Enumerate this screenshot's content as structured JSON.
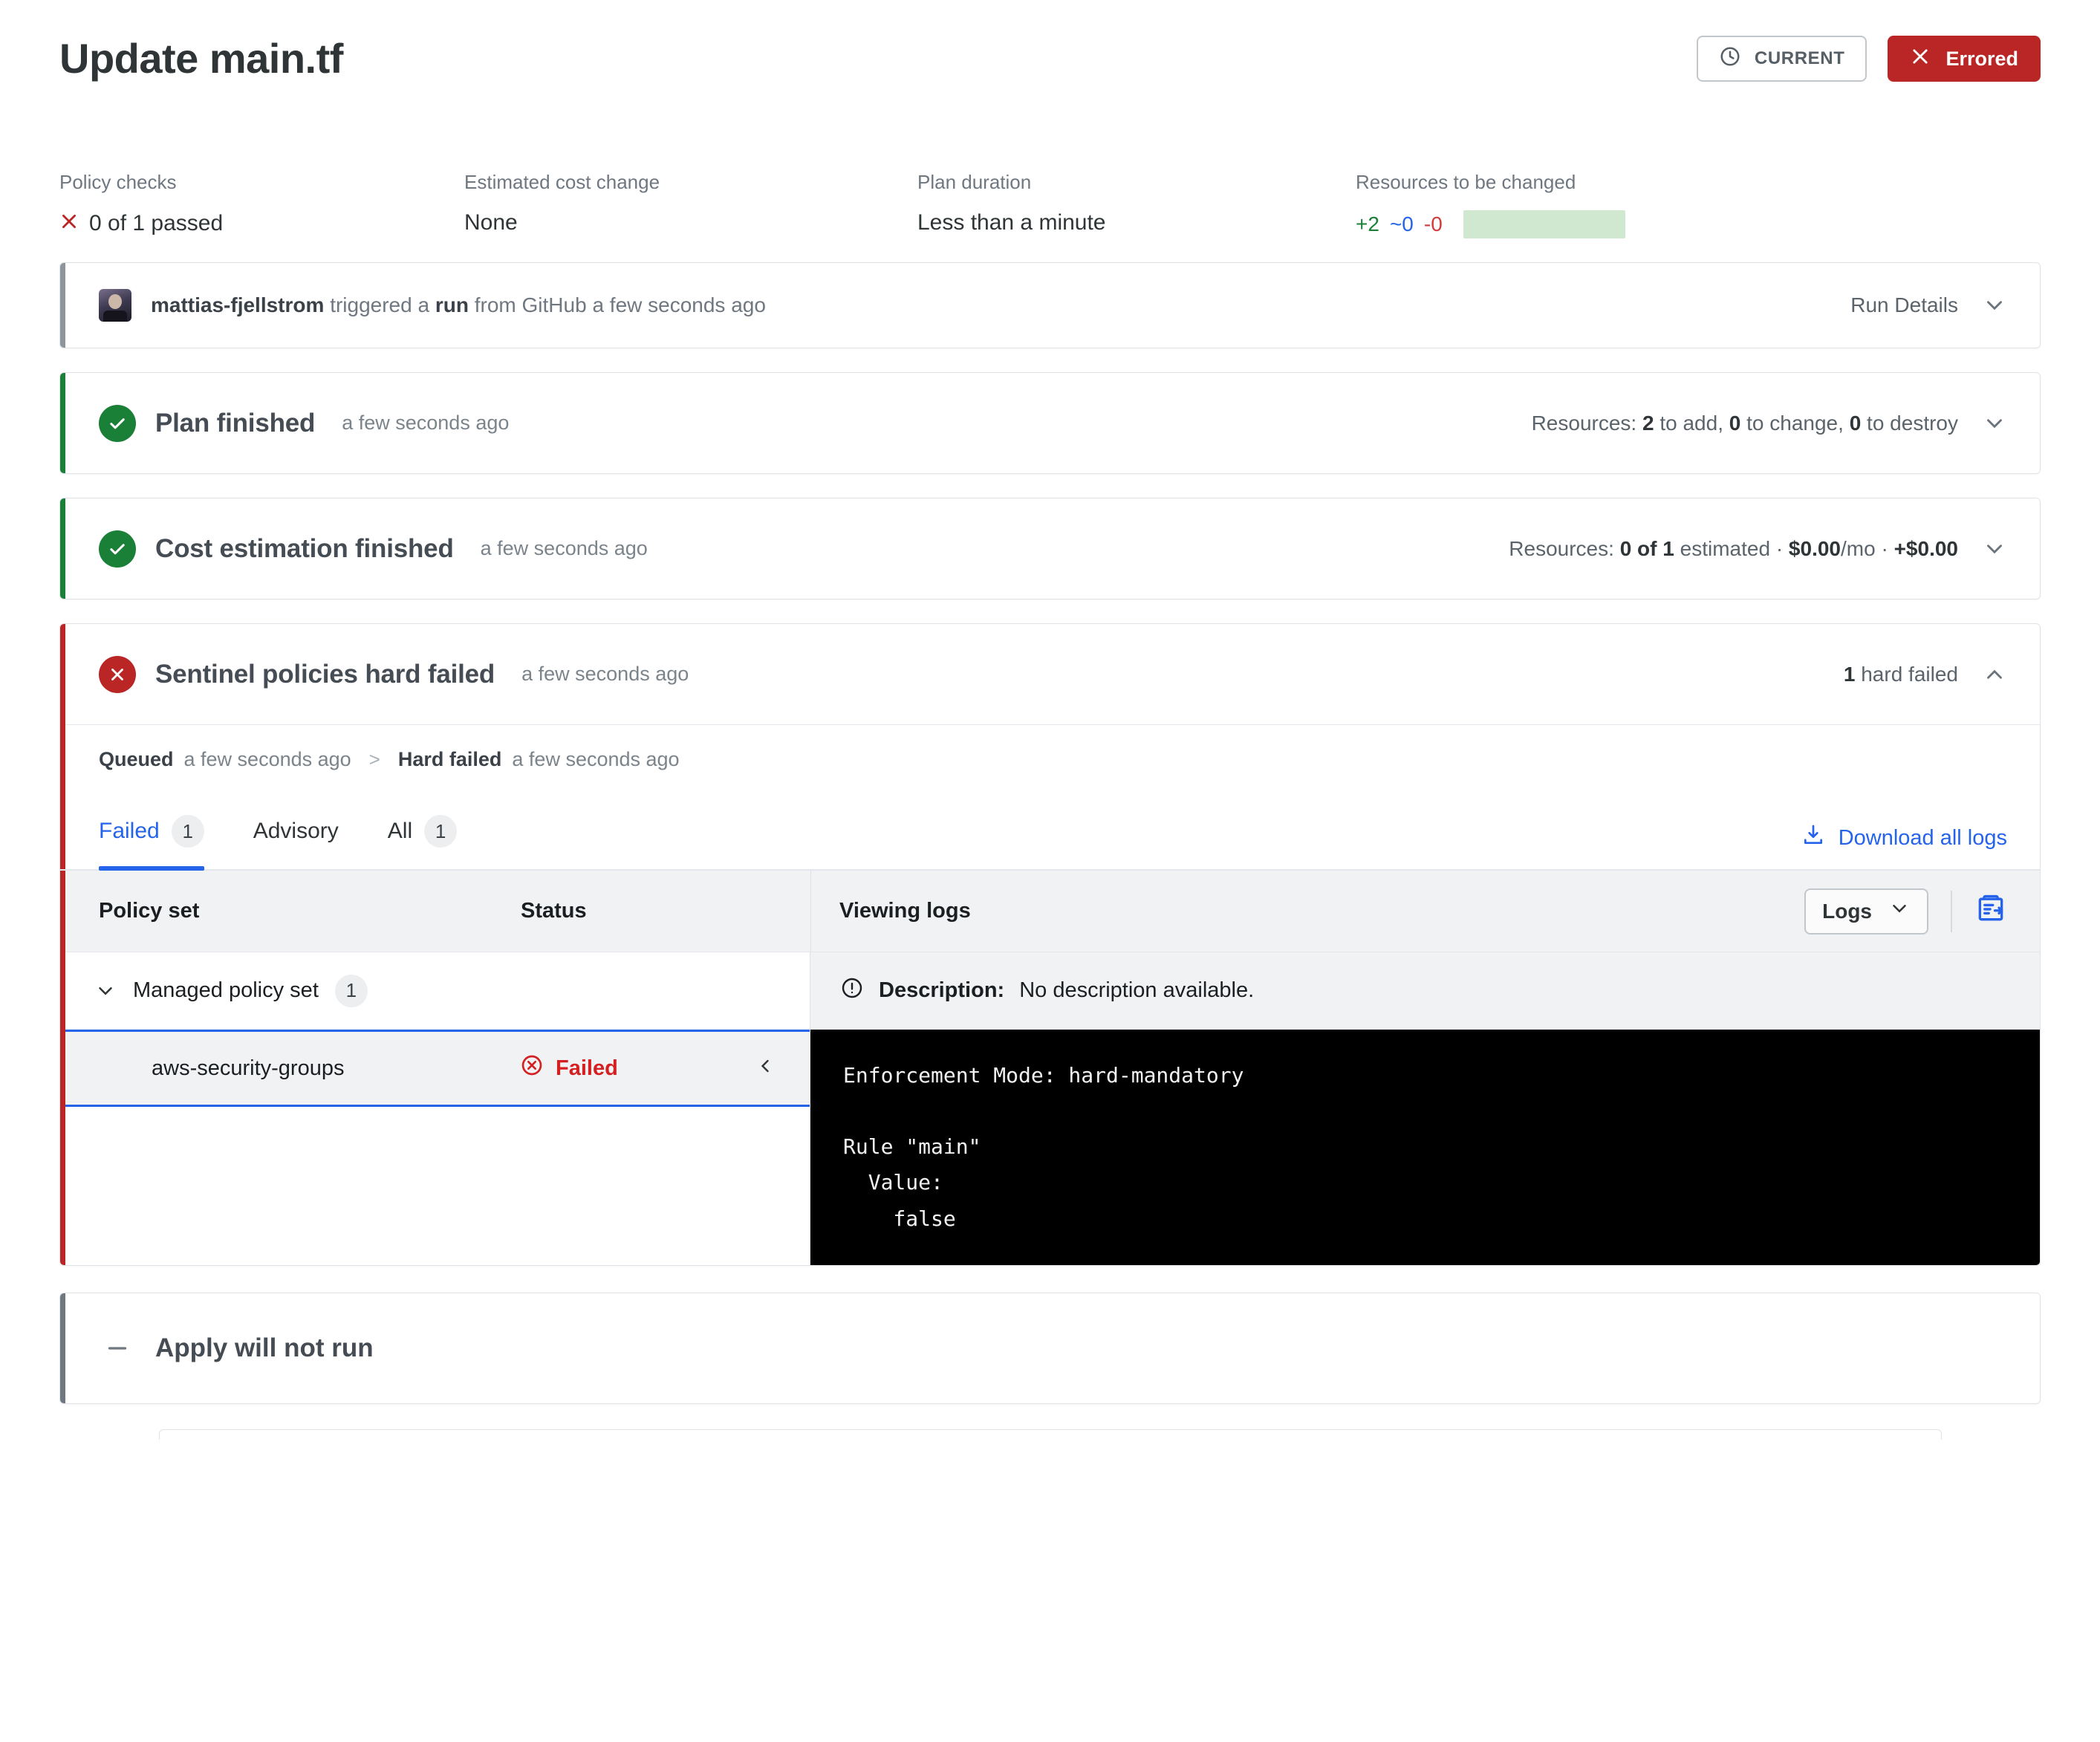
{
  "header": {
    "title": "Update main.tf",
    "current_badge": {
      "label": "CURRENT",
      "icon": "clock-icon"
    },
    "status_badge": {
      "label": "Errored",
      "icon": "x-icon",
      "color": "#ba2525"
    }
  },
  "meta": [
    {
      "label": "Policy checks",
      "value": "0 of 1 passed",
      "icon": "x-icon"
    },
    {
      "label": "Estimated cost change",
      "value": "None"
    },
    {
      "label": "Plan duration",
      "value": "Less than a minute"
    },
    {
      "label": "Resources to be changed",
      "add": "+2",
      "change": "~0",
      "destroy": "-0"
    }
  ],
  "trigger_card": {
    "user": "mattias-fjellstrom",
    "text_1": "triggered a",
    "action": "run",
    "text_2": "from GitHub a few seconds ago",
    "details_label": "Run Details"
  },
  "plan_card": {
    "title": "Plan finished",
    "time": "a few seconds ago",
    "summary_prefix": "Resources:",
    "add_count": "2",
    "add_label": "to add,",
    "change_count": "0",
    "change_label": "to change,",
    "destroy_count": "0",
    "destroy_label": "to destroy"
  },
  "cost_card": {
    "title": "Cost estimation finished",
    "time": "a few seconds ago",
    "summary_prefix": "Resources:",
    "estimated_count": "0 of 1",
    "estimated_label": "estimated",
    "sep1": "·",
    "monthly": "$0.00",
    "monthly_suffix": "/mo",
    "sep2": "·",
    "delta": "+$0.00"
  },
  "sentinel_card": {
    "title": "Sentinel policies hard failed",
    "time": "a few seconds ago",
    "failed_count": "1",
    "failed_label": "hard failed",
    "breadcrumb": {
      "queued_label": "Queued",
      "queued_time": "a few seconds ago",
      "separator": ">",
      "failed_label": "Hard failed",
      "failed_time": "a few seconds ago"
    },
    "tabs": [
      {
        "label": "Failed",
        "count": "1",
        "active": true
      },
      {
        "label": "Advisory",
        "count": "",
        "active": false
      },
      {
        "label": "All",
        "count": "1",
        "active": false
      }
    ],
    "download_label": "Download all logs",
    "table": {
      "col_policy_set": "Policy set",
      "col_status": "Status",
      "col_viewing_logs": "Viewing logs",
      "logs_select_value": "Logs",
      "group_name": "Managed policy set",
      "group_count": "1",
      "policy_name": "aws-security-groups",
      "policy_status": "Failed"
    },
    "description_label": "Description:",
    "description_value": "No description available.",
    "log_text": "Enforcement Mode: hard-mandatory\n\nRule \"main\"\n  Value:\n    false"
  },
  "apply_card": {
    "title": "Apply will not run"
  }
}
